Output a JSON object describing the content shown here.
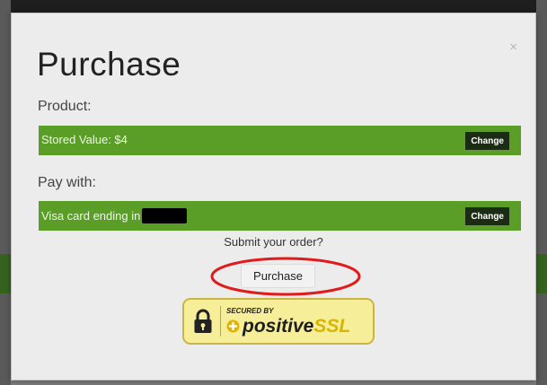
{
  "modal": {
    "title": "Purchase",
    "close_label": "×"
  },
  "product": {
    "label": "Product:",
    "value": "Stored Value: $4",
    "change_label": "Change"
  },
  "payment": {
    "label": "Pay with:",
    "value": "Visa card ending in",
    "change_label": "Change"
  },
  "submit": {
    "prompt": "Submit your order?",
    "button_label": "Purchase"
  },
  "badge": {
    "secured_by": "SECURED BY",
    "brand_positive": "positive",
    "brand_ssl": "SSL"
  },
  "colors": {
    "bar_green": "#5a9e28",
    "change_button": "#1c2c14",
    "annotation_red": "#e11b1b",
    "badge_yellow": "#f7ee9a"
  },
  "icons": {
    "close": "close-icon",
    "lock": "lock-icon",
    "plus": "plus-circle-icon"
  }
}
